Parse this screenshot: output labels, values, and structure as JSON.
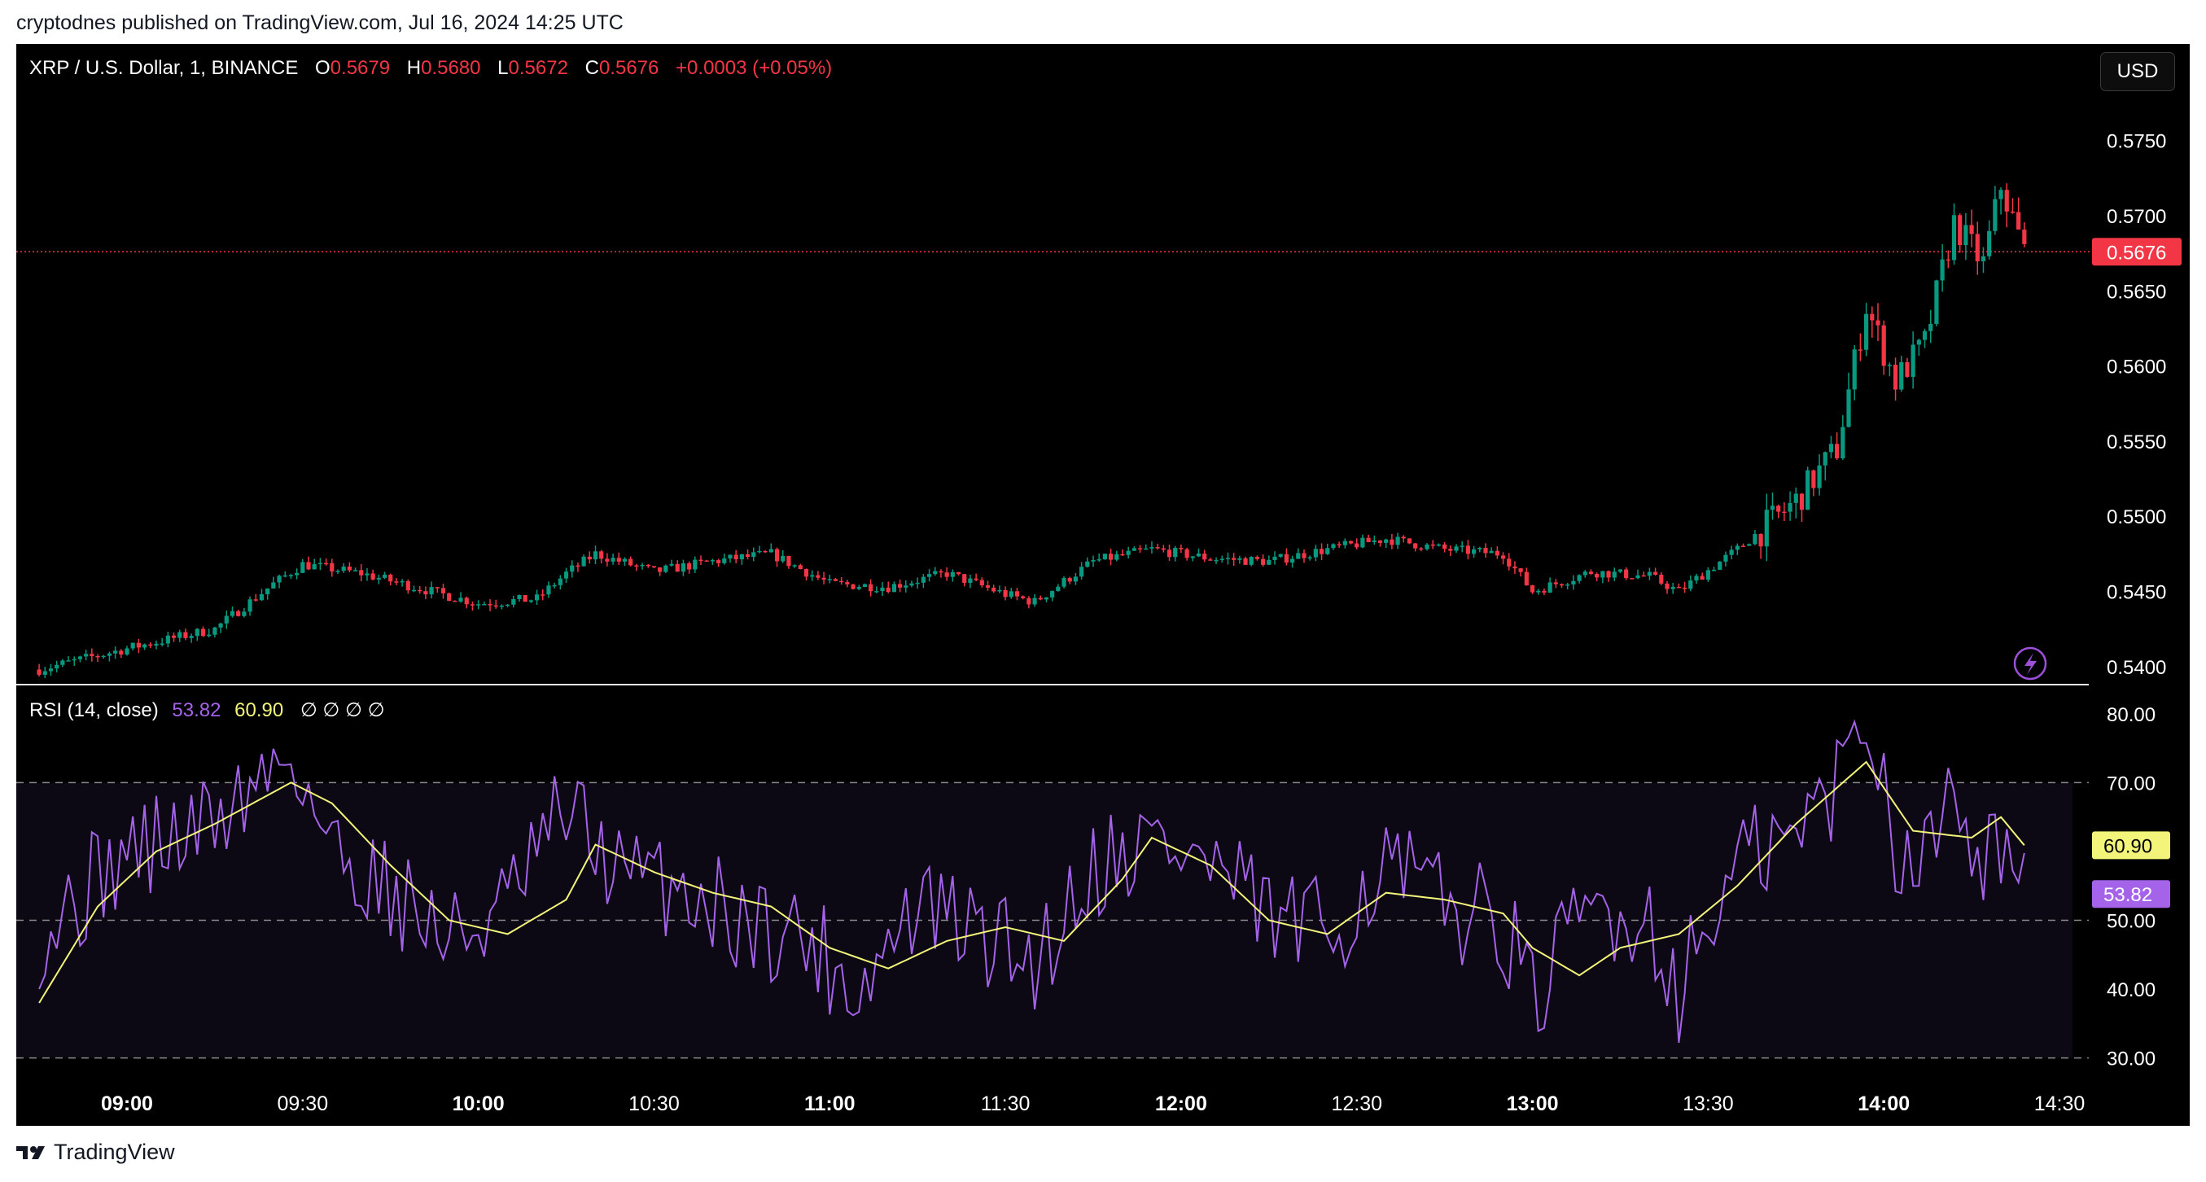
{
  "publish": "cryptodnes published on TradingView.com, Jul 16, 2024 14:25 UTC",
  "header": {
    "title": "XRP / U.S. Dollar, 1, BINANCE",
    "o_label": "O",
    "o_value": "0.5679",
    "h_label": "H",
    "h_value": "0.5680",
    "l_label": "L",
    "l_value": "0.5672",
    "c_label": "C",
    "c_value": "0.5676",
    "change": "+0.0003 (+0.05%)"
  },
  "currency_button": "USD",
  "rsi_header": {
    "label": "RSI (14, close)",
    "rsi_value": "53.82",
    "ma_value": "60.90",
    "placeholders": "∅ ∅ ∅ ∅"
  },
  "footer_brand": "TradingView",
  "colors": {
    "up": "#089981",
    "down": "#f23645",
    "rsi": "#a463e8",
    "rsi_ma": "#f3f47a",
    "last_price": "#f23645"
  },
  "icons": [
    "tradingview-logo-icon",
    "lightning-icon"
  ],
  "chart_data": [
    {
      "type": "candlestick",
      "ylim": [
        0.5395,
        0.5765
      ],
      "yticks": [
        "0.5750",
        "0.5700",
        "0.5650",
        "0.5600",
        "0.5550",
        "0.5500",
        "0.5450",
        "0.5400"
      ],
      "last_price_label": "0.5676",
      "xticks": [
        {
          "label": "09:00",
          "bold": true
        },
        {
          "label": "09:30",
          "bold": false
        },
        {
          "label": "10:00",
          "bold": true
        },
        {
          "label": "10:30",
          "bold": false
        },
        {
          "label": "11:00",
          "bold": true
        },
        {
          "label": "11:30",
          "bold": false
        },
        {
          "label": "12:00",
          "bold": true
        },
        {
          "label": "12:30",
          "bold": false
        },
        {
          "label": "13:00",
          "bold": true
        },
        {
          "label": "13:30",
          "bold": false
        },
        {
          "label": "14:00",
          "bold": true
        },
        {
          "label": "14:30",
          "bold": false
        }
      ],
      "close_path": [
        [
          "08:45",
          0.5398
        ],
        [
          "09:00",
          0.5412
        ],
        [
          "09:15",
          0.5425
        ],
        [
          "09:25",
          0.5455
        ],
        [
          "09:30",
          0.5468
        ],
        [
          "09:40",
          0.5462
        ],
        [
          "09:50",
          0.5452
        ],
        [
          "10:00",
          0.5442
        ],
        [
          "10:10",
          0.5445
        ],
        [
          "10:15",
          0.5462
        ],
        [
          "10:20",
          0.5475
        ],
        [
          "10:30",
          0.5463
        ],
        [
          "10:40",
          0.547
        ],
        [
          "10:50",
          0.5475
        ],
        [
          "11:00",
          0.5455
        ],
        [
          "11:10",
          0.5453
        ],
        [
          "11:20",
          0.5462
        ],
        [
          "11:30",
          0.5448
        ],
        [
          "11:35",
          0.5443
        ],
        [
          "11:45",
          0.547
        ],
        [
          "11:55",
          0.5478
        ],
        [
          "12:05",
          0.5472
        ],
        [
          "12:15",
          0.547
        ],
        [
          "12:25",
          0.5478
        ],
        [
          "12:35",
          0.5485
        ],
        [
          "12:45",
          0.5478
        ],
        [
          "12:55",
          0.5475
        ],
        [
          "13:00",
          0.545
        ],
        [
          "13:10",
          0.5463
        ],
        [
          "13:20",
          0.546
        ],
        [
          "13:25",
          0.545
        ],
        [
          "13:35",
          0.5478
        ],
        [
          "13:45",
          0.551
        ],
        [
          "13:52",
          0.5545
        ],
        [
          "13:57",
          0.564
        ],
        [
          "14:02",
          0.559
        ],
        [
          "14:07",
          0.5615
        ],
        [
          "14:12",
          0.5695
        ],
        [
          "14:17",
          0.5668
        ],
        [
          "14:20",
          0.572
        ],
        [
          "14:24",
          0.5676
        ]
      ]
    },
    {
      "type": "line",
      "title": "RSI (14, close)",
      "ylim": [
        27,
        84
      ],
      "yticks": [
        "80.00",
        "70.00",
        "60.00",
        "50.00",
        "40.00",
        "30.00"
      ],
      "band": [
        30,
        70
      ],
      "midline": 50,
      "series": [
        {
          "name": "RSI",
          "last": 53.82,
          "points": [
            [
              "08:45",
              48
            ],
            [
              "09:00",
              60
            ],
            [
              "09:10",
              62
            ],
            [
              "09:20",
              68
            ],
            [
              "09:28",
              75
            ],
            [
              "09:35",
              60
            ],
            [
              "09:45",
              55
            ],
            [
              "09:55",
              47
            ],
            [
              "10:05",
              52
            ],
            [
              "10:15",
              66
            ],
            [
              "10:25",
              56
            ],
            [
              "10:35",
              55
            ],
            [
              "10:45",
              50
            ],
            [
              "10:55",
              48
            ],
            [
              "11:05",
              40
            ],
            [
              "11:15",
              52
            ],
            [
              "11:25",
              48
            ],
            [
              "11:35",
              44
            ],
            [
              "11:45",
              58
            ],
            [
              "11:55",
              62
            ],
            [
              "12:05",
              58
            ],
            [
              "12:15",
              50
            ],
            [
              "12:25",
              48
            ],
            [
              "12:35",
              58
            ],
            [
              "12:45",
              52
            ],
            [
              "12:55",
              50
            ],
            [
              "13:00",
              38
            ],
            [
              "13:10",
              52
            ],
            [
              "13:20",
              50
            ],
            [
              "13:25",
              40
            ],
            [
              "13:35",
              58
            ],
            [
              "13:45",
              62
            ],
            [
              "13:52",
              70
            ],
            [
              "13:57",
              81
            ],
            [
              "14:02",
              62
            ],
            [
              "14:07",
              58
            ],
            [
              "14:12",
              73
            ],
            [
              "14:17",
              58
            ],
            [
              "14:20",
              63
            ],
            [
              "14:24",
              53.82
            ]
          ]
        },
        {
          "name": "RSI-based MA",
          "last": 60.9,
          "points": [
            [
              "08:45",
              38
            ],
            [
              "08:55",
              52
            ],
            [
              "09:05",
              60
            ],
            [
              "09:15",
              64
            ],
            [
              "09:28",
              70
            ],
            [
              "09:35",
              67
            ],
            [
              "09:45",
              58
            ],
            [
              "09:55",
              50
            ],
            [
              "10:05",
              48
            ],
            [
              "10:15",
              53
            ],
            [
              "10:20",
              61
            ],
            [
              "10:30",
              57
            ],
            [
              "10:40",
              54
            ],
            [
              "10:50",
              52
            ],
            [
              "11:00",
              46
            ],
            [
              "11:10",
              43
            ],
            [
              "11:20",
              47
            ],
            [
              "11:30",
              49
            ],
            [
              "11:40",
              47
            ],
            [
              "11:50",
              56
            ],
            [
              "11:55",
              62
            ],
            [
              "12:05",
              58
            ],
            [
              "12:15",
              50
            ],
            [
              "12:25",
              48
            ],
            [
              "12:35",
              54
            ],
            [
              "12:45",
              53
            ],
            [
              "12:55",
              51
            ],
            [
              "13:00",
              46
            ],
            [
              "13:08",
              42
            ],
            [
              "13:15",
              46
            ],
            [
              "13:25",
              48
            ],
            [
              "13:35",
              55
            ],
            [
              "13:45",
              64
            ],
            [
              "13:57",
              73
            ],
            [
              "14:05",
              63
            ],
            [
              "14:15",
              62
            ],
            [
              "14:20",
              65
            ],
            [
              "14:24",
              60.9
            ]
          ]
        }
      ]
    }
  ]
}
